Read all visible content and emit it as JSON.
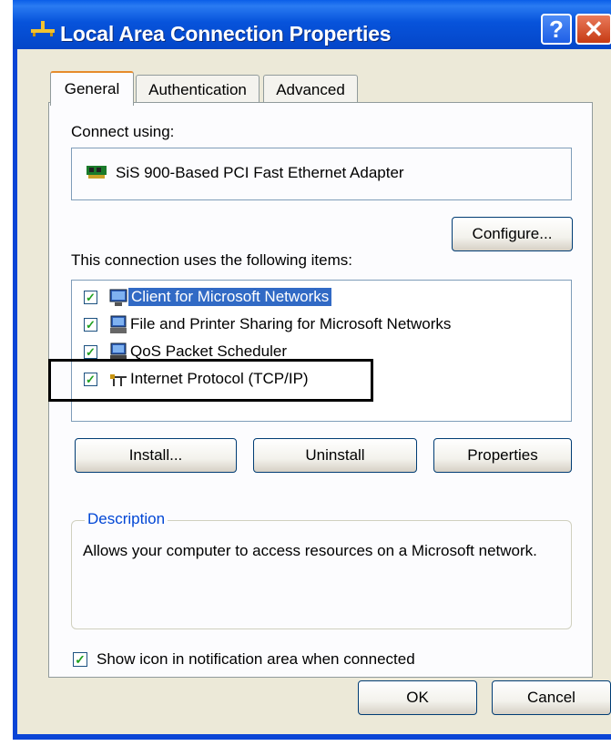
{
  "window": {
    "title": "Local Area Connection Properties",
    "help_glyph": "?",
    "close_glyph": "✕"
  },
  "tabs": [
    {
      "label": "General",
      "active": true
    },
    {
      "label": "Authentication",
      "active": false
    },
    {
      "label": "Advanced",
      "active": false
    }
  ],
  "general": {
    "connect_using_label": "Connect using:",
    "adapter_name": "SiS 900-Based PCI Fast Ethernet Adapter",
    "configure_label": "Configure...",
    "items_label": "This connection uses the following items:",
    "items": [
      {
        "label": "Client for Microsoft Networks",
        "checked": true,
        "selected": true,
        "icon": "network-client-icon"
      },
      {
        "label": "File and Printer Sharing for Microsoft Networks",
        "checked": true,
        "selected": false,
        "icon": "file-printer-sharing-icon"
      },
      {
        "label": "QoS Packet Scheduler",
        "checked": true,
        "selected": false,
        "icon": "qos-scheduler-icon"
      },
      {
        "label": "Internet Protocol (TCP/IP)",
        "checked": true,
        "selected": false,
        "icon": "protocol-icon"
      }
    ],
    "install_label": "Install...",
    "uninstall_label": "Uninstall",
    "properties_label": "Properties",
    "description_title": "Description",
    "description_text": "Allows your computer to access resources on a Microsoft network.",
    "notify_label": "Show icon in notification area when connected",
    "notify_checked": true
  },
  "footer": {
    "ok_label": "OK",
    "cancel_label": "Cancel"
  },
  "colors": {
    "titlebar": "#0753db",
    "client_bg": "#ece9d8",
    "selection": "#316ac5",
    "group_label": "#0046d5"
  }
}
